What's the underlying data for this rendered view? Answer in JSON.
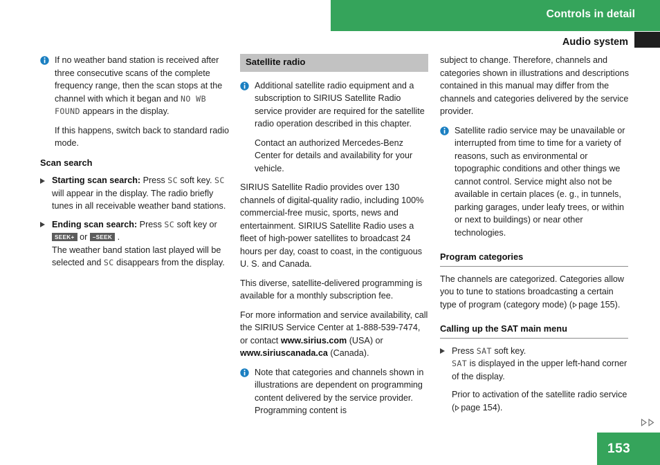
{
  "header": {
    "chapter_title": "Controls in detail",
    "section_title": "Audio system",
    "tab_icon": "chapter-tab-marker"
  },
  "footer": {
    "page_number": "153",
    "continue_marker": "▷▷"
  },
  "colors": {
    "brand_green": "#35a45b",
    "section_bar_gray": "#c2c2c2",
    "info_icon_blue": "#1a7fc1",
    "tab_black": "#1f1f1f",
    "key_pill_gray": "#5c5c5c"
  },
  "column1": {
    "note1": {
      "icon": "info-icon",
      "para1_a": "If no weather band station is received after three consecutive scans of the complete frequency range, then the scan stops at the channel with which it began and ",
      "para1_display": "NO WB FOUND",
      "para1_b": " appears in the display.",
      "para2": "If this happens, switch back to standard radio mode."
    },
    "heading": "Scan search",
    "bullet1": {
      "label": "Starting scan search:",
      "text_a": " Press ",
      "display1": "SC",
      "text_b": " soft key. ",
      "display2": "SC",
      "text_c": " will appear in the display. The radio briefly tunes in all receivable weather band stations."
    },
    "bullet2": {
      "label": "Ending scan search:",
      "text_a": " Press ",
      "display1": "SC",
      "text_b": " soft key or ",
      "key1": "SEEK+",
      "text_c": " or ",
      "key2": "–SEEK",
      "text_d": " .",
      "sub_a": "The weather band station last played will be selected and ",
      "sub_display": "SC",
      "sub_b": " disappears from the display."
    }
  },
  "column2": {
    "section_bar": "Satellite radio",
    "note1": {
      "icon": "info-icon",
      "para1": "Additional satellite radio equipment and a subscription to SIRIUS Satellite Radio service provider are required for the satellite radio operation described in this chapter.",
      "para2": "Contact an authorized Mercedes-Benz Center for details and availability for your vehicle."
    },
    "para1": "SIRIUS Satellite Radio provides over 130 channels of digital-quality radio, including 100% commercial-free music, sports, news and entertainment. SIRIUS Satellite Radio uses a fleet of high-power satellites to broadcast 24 hours per day, coast to coast, in the contiguous U. S. and Canada.",
    "para2": "This diverse, satellite-delivered programming is available for a monthly subscription fee.",
    "para3_a": "For more information and service availability, call the SIRIUS Service Center at 1-888-539-7474, or contact ",
    "para3_link1": "www.sirius.com",
    "para3_b": " (USA) or ",
    "para3_link2": "www.siriuscanada.ca",
    "para3_c": " (Canada).",
    "note2": {
      "icon": "info-icon",
      "para1": "Note that categories and channels shown in illustrations are dependent on programming content delivered by the service provider. Programming content is"
    }
  },
  "column3": {
    "continued_para": "subject to change. Therefore, channels and categories shown in illustrations and descriptions contained in this manual may differ from the channels and categories delivered by the service provider.",
    "note1": {
      "icon": "info-icon",
      "para1": "Satellite radio service may be unavailable or interrupted from time to time for a variety of reasons, such as environmental or topographic conditions and other things we cannot control. Service might also not be available in certain places (e. g., in tunnels, parking garages, under leafy trees, or within or next to buildings) or near other technologies."
    },
    "heading1": "Program categories",
    "para1_a": "The channels are categorized. Categories allow you to tune to stations broadcasting a certain type of program (category mode) (",
    "para1_ref": "page 155",
    "para1_b": ").",
    "heading2": "Calling up the SAT main menu",
    "bullet1": {
      "text_a": "Press ",
      "display1": "SAT",
      "text_b": " soft key.",
      "sub1_display": "SAT",
      "sub1_text": " is displayed in the upper left-hand corner of the display.",
      "sub2_a": "Prior to activation of the satellite radio service (",
      "sub2_ref": "page 154",
      "sub2_b": ")."
    }
  }
}
